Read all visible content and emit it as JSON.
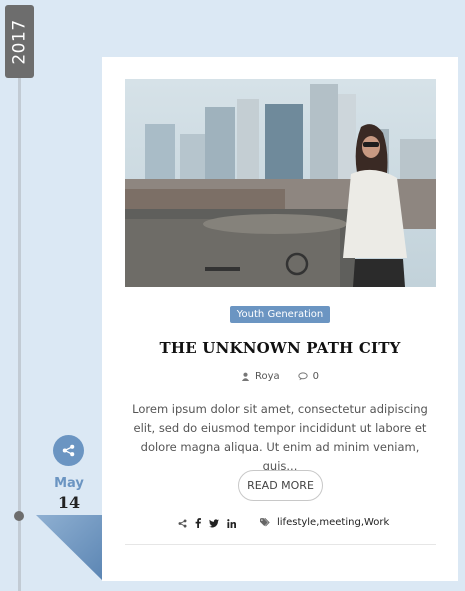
{
  "timeline": {
    "year": "2017",
    "month": "May",
    "day": "14",
    "accent_color": "#6b95c2"
  },
  "post": {
    "category": "Youth Generation",
    "title": "THE UNKNOWN PATH CITY",
    "author": "Roya",
    "comments": "0",
    "excerpt": "Lorem ipsum dolor sit amet, consectetur adipiscing elit, sed do eiusmod tempor incididunt ut labore et dolore magna aliqua. Ut enim ad minim veniam, quis...",
    "read_more": "READ MORE",
    "tags": "lifestyle,meeting,Work"
  },
  "icons": {
    "share": "share-icon",
    "author": "user-icon",
    "comments": "comment-icon",
    "facebook": "facebook-icon",
    "twitter": "twitter-icon",
    "linkedin": "linkedin-icon",
    "tags": "tag-icon"
  }
}
